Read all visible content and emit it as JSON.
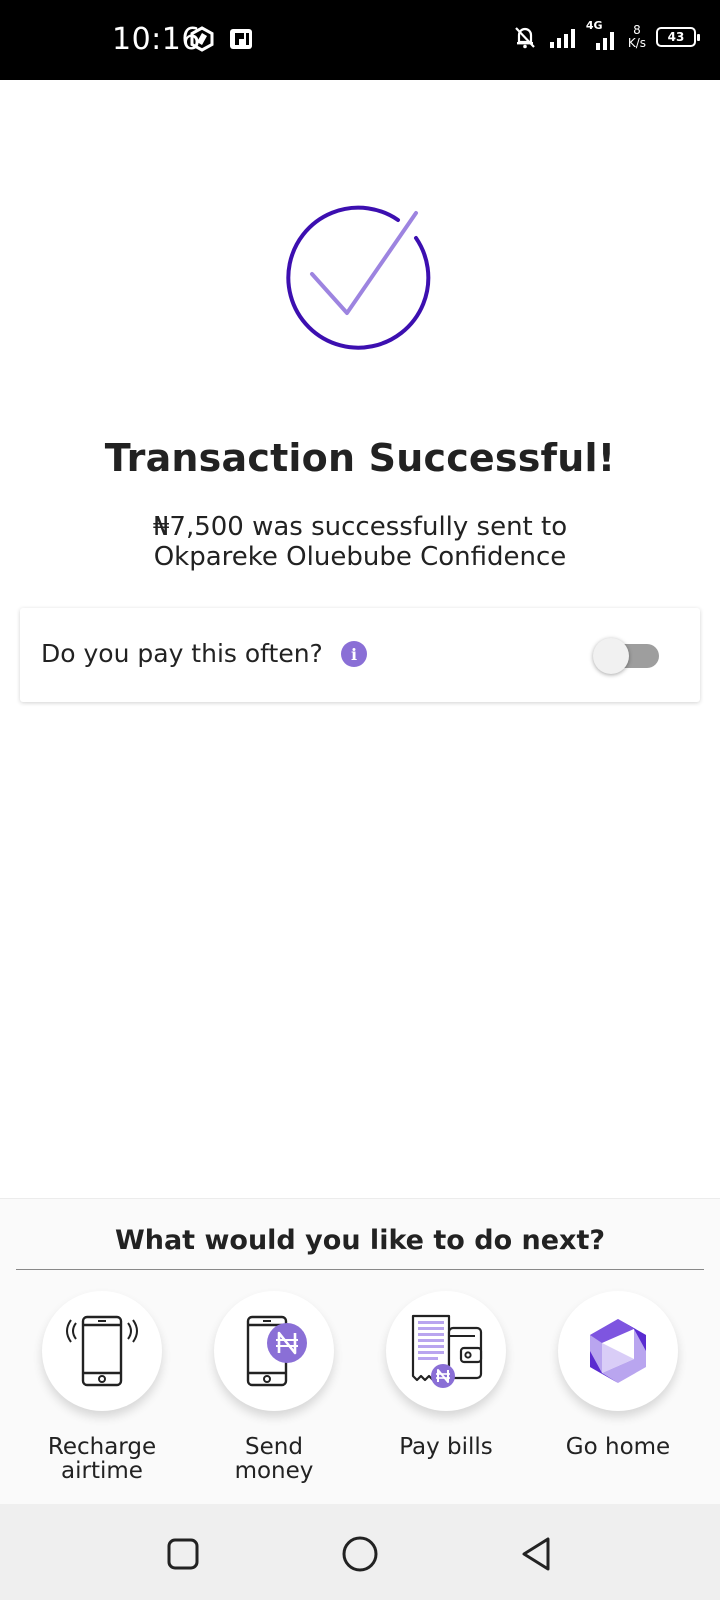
{
  "status_bar": {
    "time": "10:16",
    "network_type": "4G",
    "net_speed_value": "8",
    "net_speed_unit": "K/s",
    "battery_level": "43"
  },
  "success": {
    "title": "Transaction Successful!",
    "message": "₦7,500 was successfully sent to",
    "recipient": "Okpareke Oluebube Confidence"
  },
  "recurring_card": {
    "question": "Do you pay this often?",
    "info_icon_glyph": "i",
    "toggle_on": false
  },
  "next_actions": {
    "title": "What would you like to do next?",
    "items": [
      {
        "label": "Recharge airtime",
        "icon": "phone-signal-icon"
      },
      {
        "label": "Send money",
        "icon": "phone-naira-icon"
      },
      {
        "label": "Pay bills",
        "icon": "bill-wallet-icon"
      },
      {
        "label": "Go home",
        "icon": "logo-home-icon"
      }
    ]
  },
  "colors": {
    "brand_purple": "#3c0fb0",
    "accent_purple": "#8a6fd6",
    "light_purple": "#b9a5ef"
  }
}
